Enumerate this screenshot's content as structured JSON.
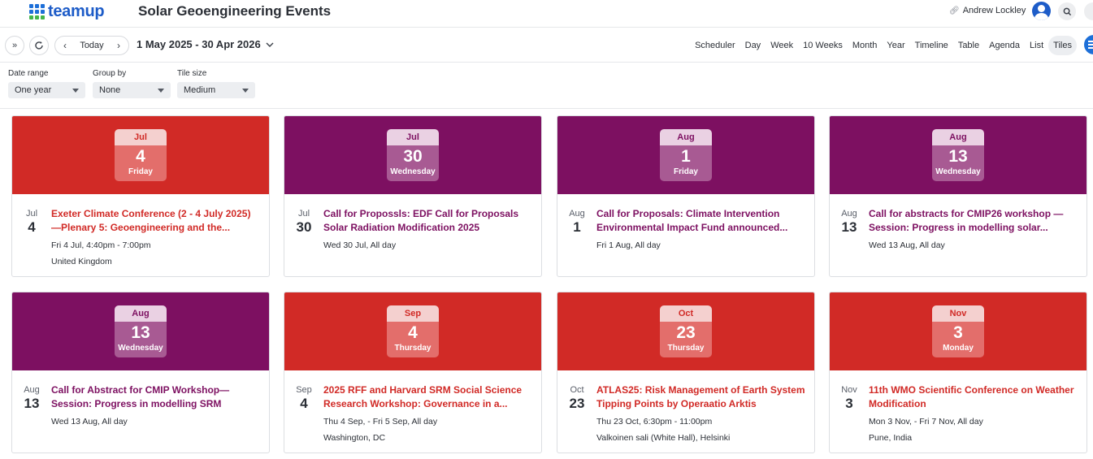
{
  "header": {
    "logo_text": "teamup",
    "calendar_title": "Solar Geoengineering Events",
    "user_name": "Andrew Lockley"
  },
  "toolbar": {
    "today_label": "Today",
    "date_range": "1 May 2025 - 30 Apr 2026",
    "views": [
      "Scheduler",
      "Day",
      "Week",
      "10 Weeks",
      "Month",
      "Year",
      "Timeline",
      "Table",
      "Agenda",
      "List",
      "Tiles"
    ],
    "active_view": "Tiles"
  },
  "filters": {
    "date_range": {
      "label": "Date range",
      "value": "One year"
    },
    "group_by": {
      "label": "Group by",
      "value": "None"
    },
    "tile_size": {
      "label": "Tile size",
      "value": "Medium"
    }
  },
  "colors": {
    "red": "#d12a26",
    "purple": "#7d1061"
  },
  "events": [
    {
      "color": "red",
      "month": "Jul",
      "day": "4",
      "weekday": "Friday",
      "title": "Exeter Climate Conference (2 - 4 July 2025) —Plenary 5: Geoengineering and the...",
      "when": "Fri 4 Jul, 4:40pm - 7:00pm",
      "where": "United Kingdom"
    },
    {
      "color": "purple",
      "month": "Jul",
      "day": "30",
      "weekday": "Wednesday",
      "title": "Call for Propossls: EDF Call for Proposals Solar Radiation Modification 2025",
      "when": "Wed 30 Jul, All day",
      "where": ""
    },
    {
      "color": "purple",
      "month": "Aug",
      "day": "1",
      "weekday": "Friday",
      "title": "Call for Proposals: Climate Intervention Environmental Impact Fund announced...",
      "when": "Fri 1 Aug, All day",
      "where": ""
    },
    {
      "color": "purple",
      "month": "Aug",
      "day": "13",
      "weekday": "Wednesday",
      "title": "Call for abstracts for CMIP26 workshop — Session: Progress in modelling solar...",
      "when": "Wed 13 Aug, All day",
      "where": ""
    },
    {
      "color": "purple",
      "month": "Aug",
      "day": "13",
      "weekday": "Wednesday",
      "title": "Call for Abstract for CMIP Workshop—Session: Progress in modelling SRM throug...",
      "when": "Wed 13 Aug, All day",
      "where": ""
    },
    {
      "color": "red",
      "month": "Sep",
      "day": "4",
      "weekday": "Thursday",
      "title": "2025 RFF and Harvard SRM Social Science Research Workshop: Governance in a...",
      "when": "Thu 4 Sep, - Fri 5 Sep, All day",
      "where": "Washington, DC"
    },
    {
      "color": "red",
      "month": "Oct",
      "day": "23",
      "weekday": "Thursday",
      "title": "ATLAS25: Risk Management of Earth System Tipping Points by Operaatio Arktis",
      "when": "Thu 23 Oct, 6:30pm - 11:00pm",
      "where": "Valkoinen sali (White Hall), Helsinki"
    },
    {
      "color": "red",
      "month": "Nov",
      "day": "3",
      "weekday": "Monday",
      "title": "11th WMO Scientific Conference on Weather Modification",
      "when": "Mon 3 Nov, - Fri 7 Nov, All day",
      "where": "Pune, India"
    }
  ]
}
